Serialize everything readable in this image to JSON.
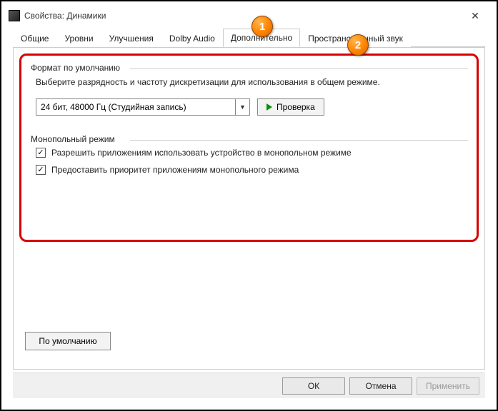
{
  "window": {
    "title": "Свойства: Динамики"
  },
  "tabs": {
    "t0": "Общие",
    "t1": "Уровни",
    "t2": "Улучшения",
    "t3": "Dolby Audio",
    "t4": "Дополнительно",
    "t5": "Пространственный звук"
  },
  "default_format": {
    "group_title": "Формат по умолчанию",
    "description": "Выберите разрядность и частоту дискретизации для использования в общем режиме.",
    "combo_value": "24 бит, 48000 Гц (Студийная запись)",
    "test_button": "Проверка"
  },
  "exclusive": {
    "group_title": "Монопольный режим",
    "allow_label": "Разрешить приложениям использовать устройство в монопольном режиме",
    "priority_label": "Предоставить приоритет приложениям монопольного режима"
  },
  "defaults_button": "По умолчанию",
  "footer": {
    "ok": "ОК",
    "cancel": "Отмена",
    "apply": "Применить"
  },
  "callouts": {
    "c1": "1",
    "c2": "2"
  }
}
